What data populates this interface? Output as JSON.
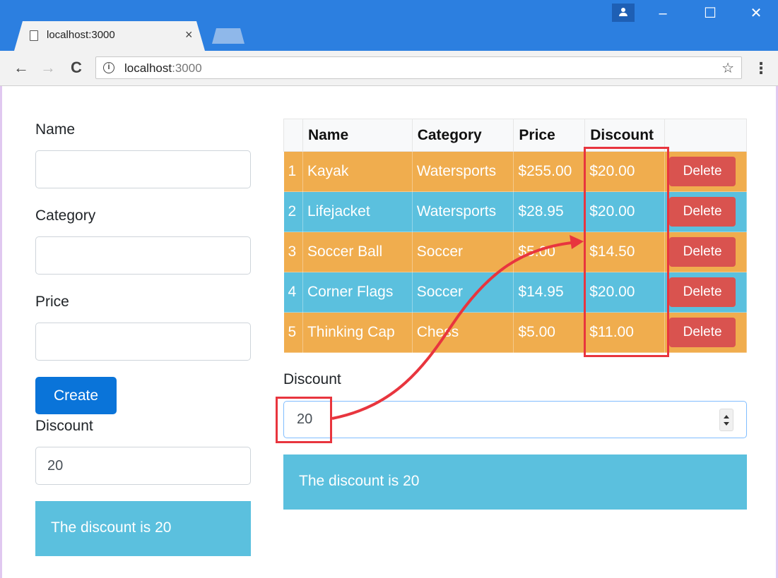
{
  "browser": {
    "tab_title": "localhost:3000",
    "tab_close": "×",
    "url_host": "localhost",
    "url_port": ":3000",
    "back_icon": "←",
    "forward_icon": "→",
    "reload_icon": "C",
    "info_icon": "i",
    "star_icon": "☆",
    "menu_icon": "⋮",
    "minimize_icon": "–",
    "maximize_icon": "☐",
    "close_icon": "✕"
  },
  "form": {
    "name_label": "Name",
    "name_value": "",
    "category_label": "Category",
    "category_value": "",
    "price_label": "Price",
    "price_value": "",
    "create_label": "Create",
    "discount_label": "Discount",
    "discount_value": "20",
    "alert_text": "The discount is 20"
  },
  "table": {
    "headers": [
      "",
      "Name",
      "Category",
      "Price",
      "Discount",
      ""
    ],
    "rows": [
      {
        "index": "1",
        "name": "Kayak",
        "category": "Watersports",
        "price": "$255.00",
        "discount": "$20.00",
        "action": "Delete",
        "style": "warning"
      },
      {
        "index": "2",
        "name": "Lifejacket",
        "category": "Watersports",
        "price": "$28.95",
        "discount": "$20.00",
        "action": "Delete",
        "style": "info"
      },
      {
        "index": "3",
        "name": "Soccer Ball",
        "category": "Soccer",
        "price": "$5.00",
        "discount": "$14.50",
        "action": "Delete",
        "style": "warning"
      },
      {
        "index": "4",
        "name": "Corner Flags",
        "category": "Soccer",
        "price": "$14.95",
        "discount": "$20.00",
        "action": "Delete",
        "style": "info"
      },
      {
        "index": "5",
        "name": "Thinking Cap",
        "category": "Chess",
        "price": "$5.00",
        "discount": "$11.00",
        "action": "Delete",
        "style": "warning"
      }
    ]
  },
  "discount_panel": {
    "label": "Discount",
    "value": "20",
    "alert_text": "The discount is 20"
  },
  "colors": {
    "titlebar": "#2c7fe0",
    "primary": "#0a74d9",
    "warning_row": "#f0ad4e",
    "info_row": "#5bc0de",
    "danger": "#d9534f",
    "annotation": "#e8353e"
  }
}
